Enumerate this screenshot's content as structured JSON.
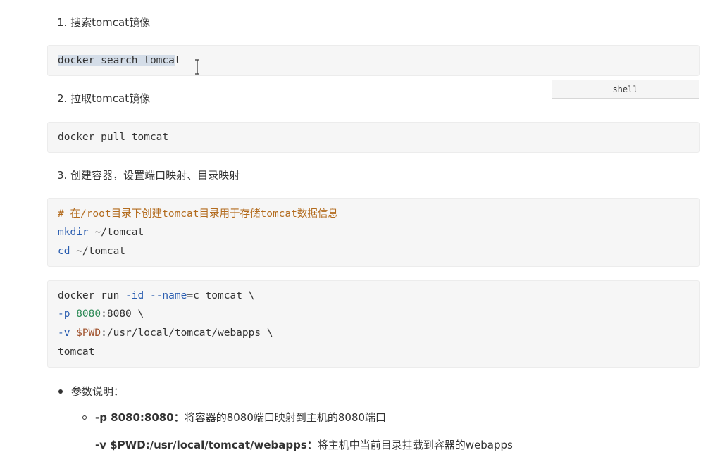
{
  "steps": {
    "search_heading": "1. 搜索tomcat镜像",
    "search_cmd_selected": "docker search tomca",
    "search_cmd_rest": "t",
    "pull_heading": "2. 拉取tomcat镜像",
    "code_lang": "shell",
    "pull_cmd": "docker pull tomcat",
    "create_heading": "3. 创建容器，设置端口映射、目录映射"
  },
  "mkdir_block": {
    "comment": "# 在/root目录下创建tomcat目录用于存储tomcat数据信息",
    "mkdir_kw": "mkdir",
    "mkdir_arg": " ~/tomcat",
    "cd_kw": "cd",
    "cd_arg": " ~/tomcat"
  },
  "run_block": {
    "l1_a": "docker run ",
    "l1_opt1": "-id",
    "l1_b": " ",
    "l1_opt2": "--name",
    "l1_c": "=c_tomcat \\",
    "l2_opt": "-p",
    "l2_b": " ",
    "l2_num": "8080",
    "l2_c": ":8080 \\",
    "l3_opt": "-v",
    "l3_b": " ",
    "l3_var": "$PWD",
    "l3_c": ":/usr/local/tomcat/webapps \\",
    "l4": "tomcat"
  },
  "params": {
    "title": "参数说明：",
    "p_flag": "-p 8080:8080：",
    "p_desc": "将容器的8080端口映射到主机的8080端口",
    "v_flag": "-v $PWD:/usr/local/tomcat/webapps：",
    "v_desc": "将主机中当前目录挂载到容器的webapps"
  }
}
